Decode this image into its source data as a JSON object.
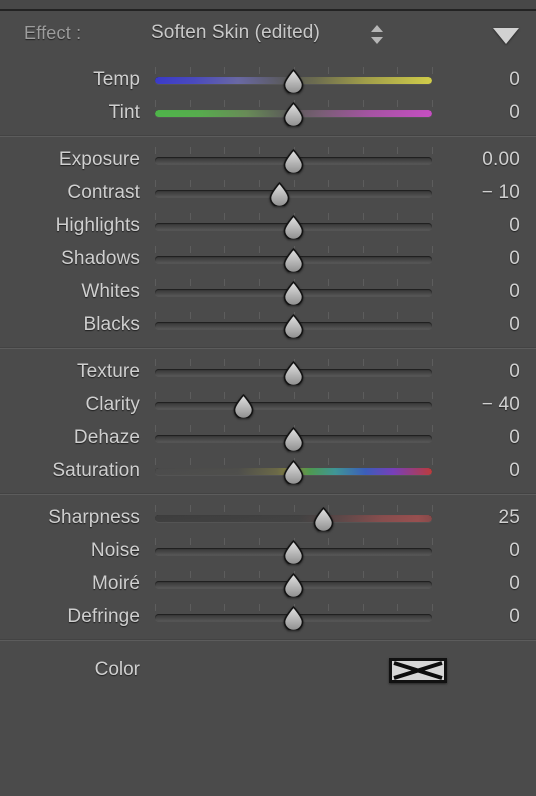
{
  "panel": {
    "title_label": "Effect :",
    "effect_value": "Soften Skin (edited)",
    "stepper_icon": "stepper-up-down-icon",
    "disclosure_icon": "disclosure-triangle-down-icon",
    "background_color": "#4b4b4b",
    "accent_text_color": "#cfcfcf"
  },
  "groups": [
    {
      "name": "white-balance",
      "rows": [
        {
          "label": "Temp",
          "value": "0",
          "pos": 50,
          "gradient": "g-temp",
          "dim": false
        },
        {
          "label": "Tint",
          "value": "0",
          "pos": 50,
          "gradient": "g-tint",
          "dim": false
        }
      ]
    },
    {
      "name": "tone",
      "rows": [
        {
          "label": "Exposure",
          "value": "0.00",
          "pos": 50,
          "gradient": "",
          "dim": false
        },
        {
          "label": "Contrast",
          "value": "− 10",
          "pos": 45,
          "gradient": "",
          "dim": false
        },
        {
          "label": "Highlights",
          "value": "0",
          "pos": 50,
          "gradient": "",
          "dim": false
        },
        {
          "label": "Shadows",
          "value": "0",
          "pos": 50,
          "gradient": "",
          "dim": false
        },
        {
          "label": "Whites",
          "value": "0",
          "pos": 50,
          "gradient": "",
          "dim": false
        },
        {
          "label": "Blacks",
          "value": "0",
          "pos": 50,
          "gradient": "",
          "dim": false
        }
      ]
    },
    {
      "name": "presence",
      "rows": [
        {
          "label": "Texture",
          "value": "0",
          "pos": 50,
          "gradient": "",
          "dim": false
        },
        {
          "label": "Clarity",
          "value": "− 40",
          "pos": 32,
          "gradient": "",
          "dim": false
        },
        {
          "label": "Dehaze",
          "value": "0",
          "pos": 50,
          "gradient": "",
          "dim": false
        },
        {
          "label": "Saturation",
          "value": "0",
          "pos": 50,
          "gradient": "g-sat",
          "dim": false
        }
      ]
    },
    {
      "name": "detail",
      "rows": [
        {
          "label": "Sharpness",
          "value": "25",
          "pos": 61,
          "gradient": "g-sharp",
          "dim": false
        },
        {
          "label": "Noise",
          "value": "0",
          "pos": 50,
          "gradient": "",
          "dim": false
        },
        {
          "label": "Moiré",
          "value": "0",
          "pos": 50,
          "gradient": "",
          "dim": false
        },
        {
          "label": "Defringe",
          "value": "0",
          "pos": 50,
          "gradient": "",
          "dim": false
        }
      ]
    }
  ],
  "color_section": {
    "label": "Color",
    "swatch_icon": "no-color-x-swatch-icon",
    "swatch_fill": "#d6d6d6",
    "swatch_border": "#111111"
  },
  "ticks": {
    "count": 9
  }
}
